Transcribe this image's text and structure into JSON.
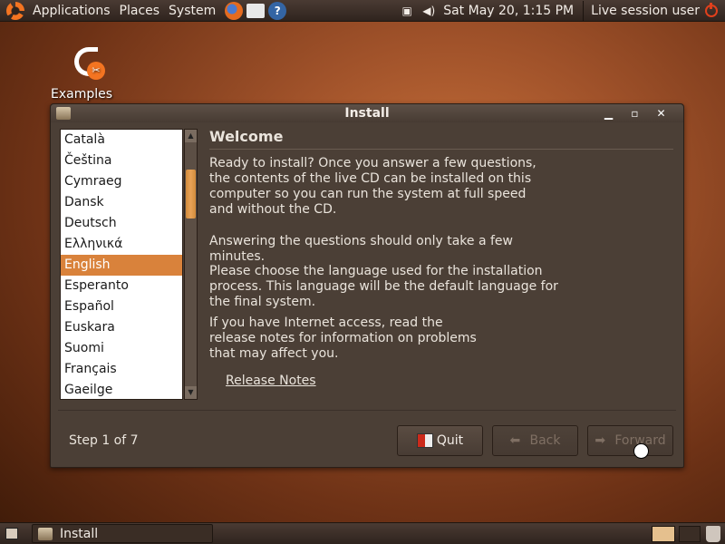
{
  "top_panel": {
    "menus": [
      "Applications",
      "Places",
      "System"
    ],
    "launchers": [
      "firefox-icon",
      "mail-icon",
      "help-icon"
    ],
    "clock": "Sat May 20,  1:15 PM",
    "session_label": "Live session user",
    "tray_icons": [
      "network-icon",
      "volume-icon"
    ]
  },
  "desktop": {
    "icons": [
      {
        "label": "Examples",
        "icon": "examples-icon"
      }
    ]
  },
  "window": {
    "title": "Install",
    "controls": [
      "minimize",
      "maximize",
      "close"
    ],
    "heading": "Welcome",
    "paragraphs": [
      "Ready to install? Once you answer a few questions, the contents of the live CD can be installed on this computer so you can run the system at full speed and without the CD.",
      "Answering the questions should only take a few minutes.",
      "Please choose the language used for the installation process. This language will be the default language for the final system.",
      "If you have Internet access, read the release notes for information on problems that may affect you."
    ],
    "release_notes_label": "Release Notes",
    "languages": [
      "Català",
      "Čeština",
      "Cymraeg",
      "Dansk",
      "Deutsch",
      "Ελληνικά",
      "English",
      "Esperanto",
      "Español",
      "Euskara",
      "Suomi",
      "Français",
      "Gaeilge"
    ],
    "selected_language": "English",
    "step_label": "Step 1 of 7",
    "buttons": {
      "quit": "Quit",
      "back": "Back",
      "forward": "Forward"
    },
    "button_states": {
      "back": "disabled",
      "forward": "disabled"
    }
  },
  "bottom_panel": {
    "task_label": "Install"
  },
  "colors": {
    "selection": "#d9823b",
    "window_bg": "#4b3f36",
    "panel_bg": "#3a2d25",
    "accent_orange": "#f47421"
  }
}
